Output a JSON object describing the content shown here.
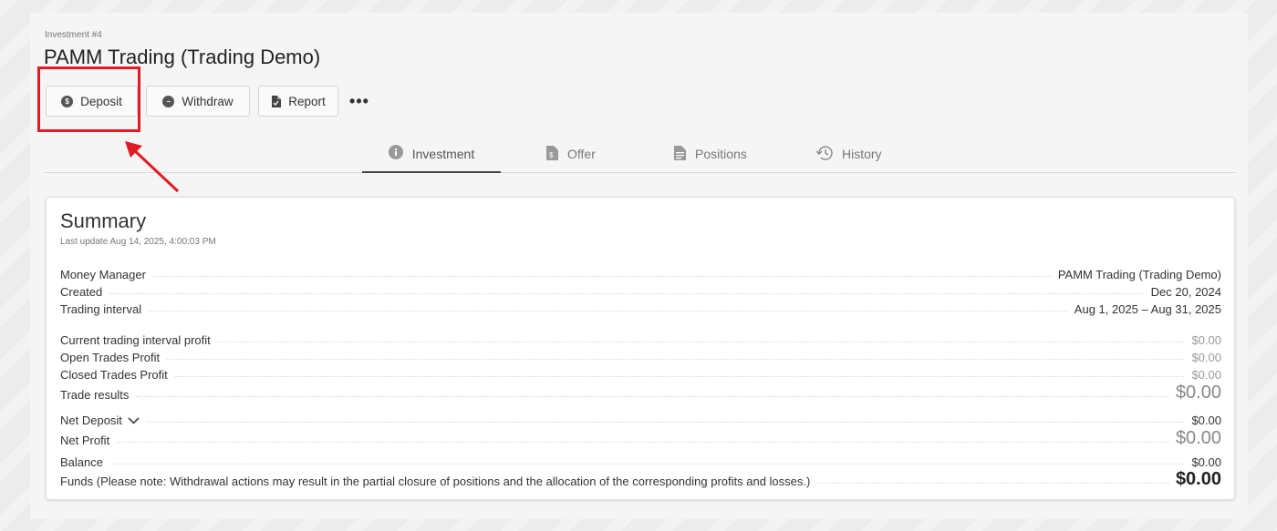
{
  "header": {
    "eyebrow": "Investment #4",
    "title": "PAMM Trading (Trading Demo)"
  },
  "actions": {
    "deposit": "Deposit",
    "withdraw": "Withdraw",
    "report": "Report",
    "more": "•••"
  },
  "tabs": [
    {
      "label": "Investment",
      "icon": "info-icon"
    },
    {
      "label": "Offer",
      "icon": "document-dollar-icon"
    },
    {
      "label": "Positions",
      "icon": "document-list-icon"
    },
    {
      "label": "History",
      "icon": "history-icon"
    }
  ],
  "summary": {
    "title": "Summary",
    "last_update": "Last update Aug 14, 2025, 4:00:03 PM",
    "rows": [
      {
        "label": "Money Manager",
        "value": "PAMM Trading (Trading Demo)"
      },
      {
        "label": "Created",
        "value": "Dec 20, 2024"
      },
      {
        "label": "Trading interval",
        "value": "Aug 1, 2025 – Aug 31, 2025"
      },
      {
        "label": "Current trading interval profit",
        "value": "$0.00"
      },
      {
        "label": "Open Trades Profit",
        "value": "$0.00"
      },
      {
        "label": "Closed Trades Profit",
        "value": "$0.00"
      },
      {
        "label": "Trade results",
        "value": "$0.00"
      },
      {
        "label": "Net Deposit",
        "value": "$0.00"
      },
      {
        "label": "Net Profit",
        "value": "$0.00"
      },
      {
        "label": "Balance",
        "value": "$0.00"
      },
      {
        "label": "Funds (Please note: Withdrawal actions may result in the partial closure of positions and the allocation of the corresponding profits and losses.)",
        "value": "$0.00"
      }
    ]
  },
  "colors": {
    "highlight": "#e01b24",
    "panel_bg": "#f5f5f5"
  }
}
